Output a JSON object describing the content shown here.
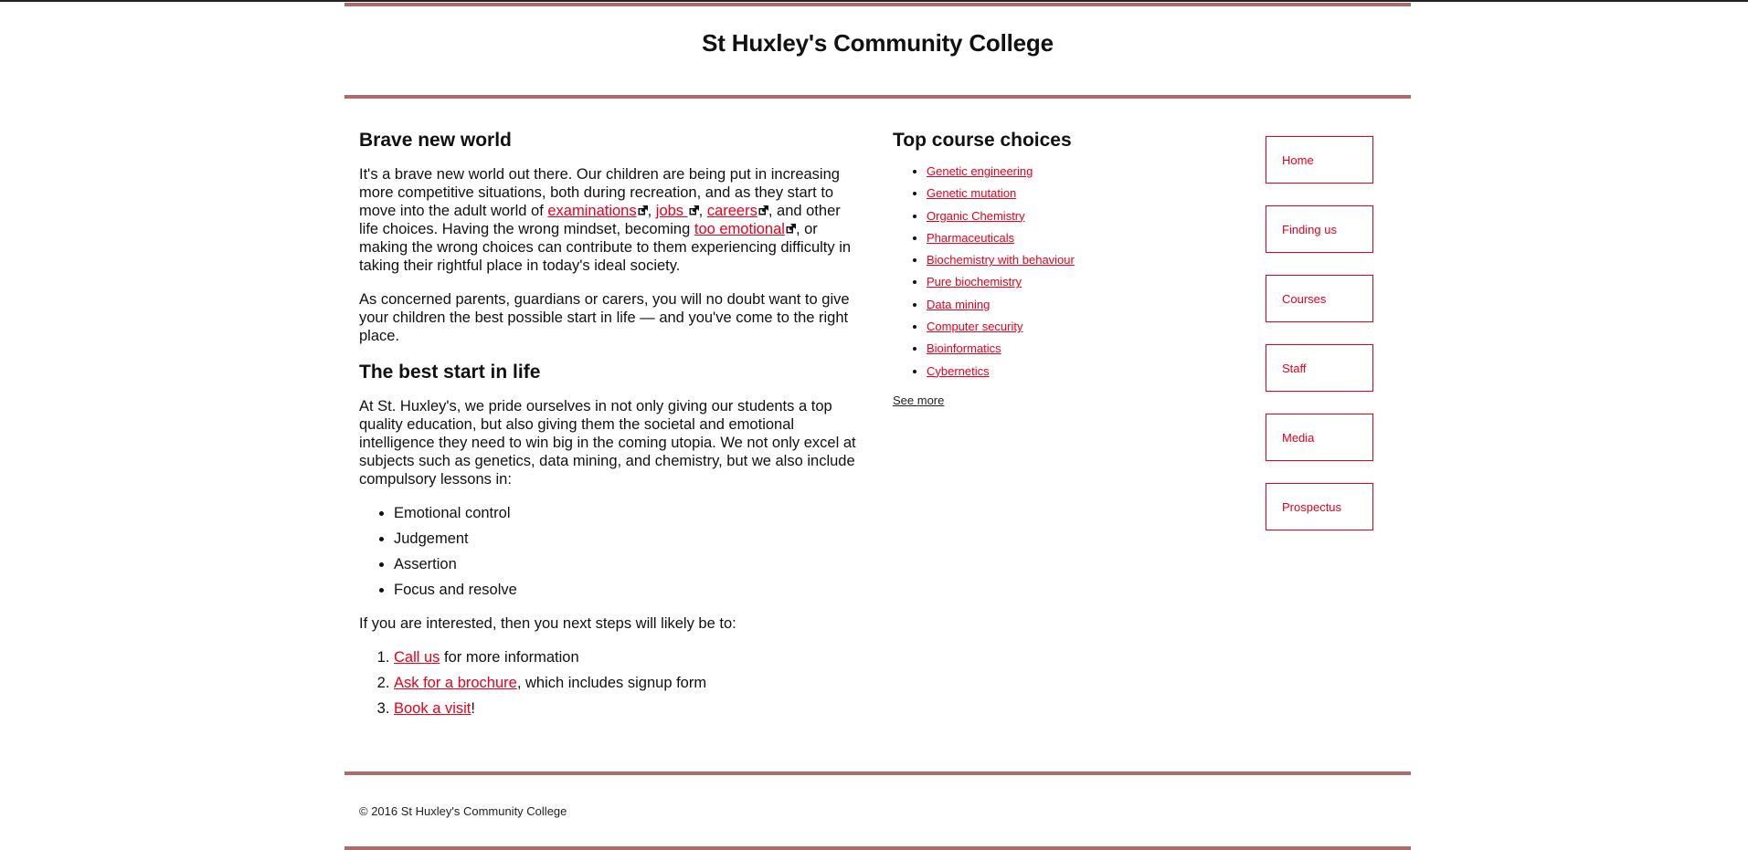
{
  "site": {
    "title": "St Huxley's Community College"
  },
  "article": {
    "heading1": "Brave new world",
    "p1": {
      "t1": "It's a brave new world out there. Our children are being put in increasing more competitive situations, both during recreation, and as they start to move into the adult world of ",
      "link_examinations": "examinations",
      "sep1": ", ",
      "link_jobs": "jobs ",
      "sep2": ", ",
      "link_careers": "careers",
      "t2": ", and other life choices. Having the wrong mindset, becoming ",
      "link_emotional": "too emotional",
      "t3": ", or making the wrong choices can contribute to them experiencing difficulty in taking their rightful place in today's ideal society."
    },
    "p2": "As concerned parents, guardians or carers, you will no doubt want to give your children the best possible start in life — and you've come to the right place.",
    "heading2": "The best start in life",
    "p3": "At St. Huxley's, we pride ourselves in not only giving our students a top quality education, but also giving them the societal and emotional intelligence they need to win big in the coming utopia. We not only excel at subjects such as genetics, data mining, and chemistry, but we also include compulsory lessons in:",
    "lessons": [
      "Emotional control",
      "Judgement",
      "Assertion",
      "Focus and resolve"
    ],
    "p4": "If you are interested, then you next steps will likely be to:",
    "steps": [
      {
        "link": "Call us",
        "rest": " for more information"
      },
      {
        "link": "Ask for a brochure",
        "rest": ", which includes signup form"
      },
      {
        "link": "Book a visit",
        "rest": "!"
      }
    ]
  },
  "courses": {
    "heading": "Top course choices",
    "items": [
      "Genetic engineering",
      "Genetic mutation",
      "Organic Chemistry",
      "Pharmaceuticals",
      "Biochemistry with behaviour",
      "Pure biochemistry",
      "Data mining",
      "Computer security",
      "Bioinformatics",
      "Cybernetics"
    ],
    "see_more": "See more"
  },
  "nav": {
    "items": [
      "Home",
      "Finding us",
      "Courses",
      "Staff",
      "Media",
      "Prospectus"
    ]
  },
  "footer": {
    "text": "© 2016 St Huxley's Community College"
  },
  "colors": {
    "accent": "#e8001c",
    "bar": "#b06a6a"
  },
  "icons": {
    "external": "external-link-icon"
  }
}
